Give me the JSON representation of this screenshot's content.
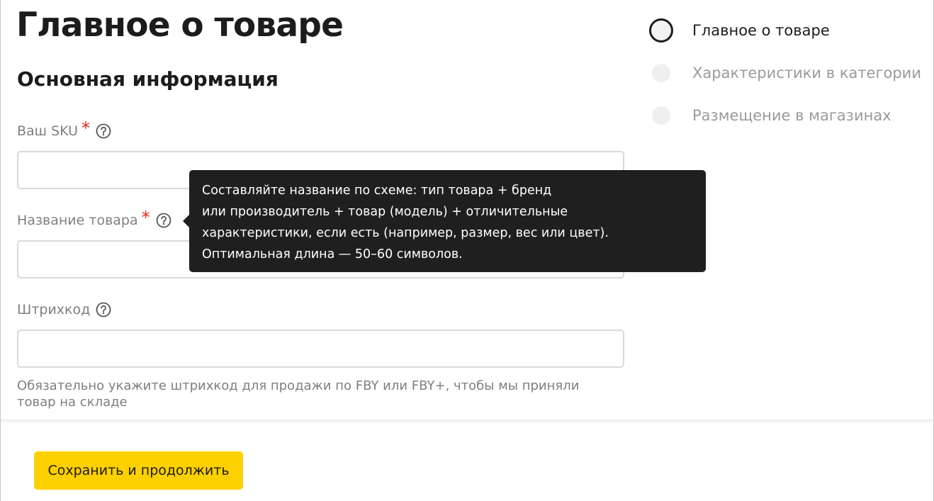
{
  "page": {
    "title": "Главное о товаре",
    "section_title": "Основная информация"
  },
  "fields": {
    "sku": {
      "label": "Ваш SKU",
      "required_mark": "*",
      "value": ""
    },
    "name": {
      "label": "Название товара",
      "required_mark": "*",
      "value": ""
    },
    "barcode": {
      "label": "Штрихкод",
      "value": "",
      "hint": "Обязательно укажите штрихкод для продажи по FBY или FBY+, чтобы мы приняли товар на складе"
    }
  },
  "tooltip": {
    "lines": [
      "Составляйте название по схеме: тип товара + бренд",
      "или производитель + товар (модель) + отличительные",
      "характеристики, если есть (например, размер, вес или цвет).",
      "Оптимальная длина — 50–60 символов."
    ]
  },
  "stepper": {
    "steps": [
      {
        "label": "Главное о товаре",
        "state": "current"
      },
      {
        "label": "Характеристики в категории",
        "state": "inactive"
      },
      {
        "label": "Размещение в магазинах",
        "state": "inactive"
      }
    ]
  },
  "footer": {
    "save_label": "Сохранить и продолжить"
  },
  "colors": {
    "accent": "#fdd000",
    "required": "#e0281b",
    "tooltip_bg": "#1f1f1f",
    "label_gray": "#7f7f7f"
  },
  "icons": {
    "help": "question-circle-icon"
  }
}
